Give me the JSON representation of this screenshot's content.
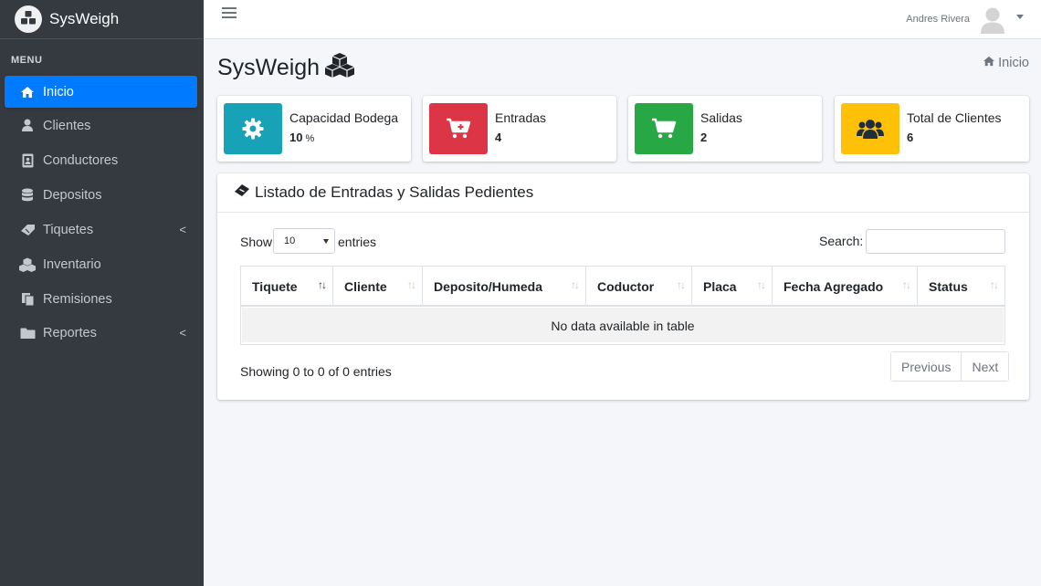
{
  "brand": {
    "name": "SysWeigh"
  },
  "sidebar": {
    "header": "MENU",
    "items": [
      {
        "label": "Inicio",
        "icon": "home-icon",
        "active": true
      },
      {
        "label": "Clientes",
        "icon": "user-icon"
      },
      {
        "label": "Conductores",
        "icon": "id-badge-icon"
      },
      {
        "label": "Depositos",
        "icon": "database-icon"
      },
      {
        "label": "Tiquetes",
        "icon": "ticket-icon",
        "has_submenu": true
      },
      {
        "label": "Inventario",
        "icon": "cubes-icon"
      },
      {
        "label": "Remisiones",
        "icon": "copy-icon"
      },
      {
        "label": "Reportes",
        "icon": "folder-icon",
        "has_submenu": true
      }
    ],
    "chevron": "<"
  },
  "header": {
    "user_name": "Andres Rivera"
  },
  "page": {
    "title": "SysWeigh",
    "breadcrumb": "Inicio"
  },
  "info_boxes": [
    {
      "label": "Capacidad Bodega",
      "value": "10",
      "unit": "%",
      "icon": "cog-icon",
      "color": "#17a2b8"
    },
    {
      "label": "Entradas",
      "value": "4",
      "icon": "cart-plus-icon",
      "color": "#dc3545"
    },
    {
      "label": "Salidas",
      "value": "2",
      "icon": "cart-icon",
      "color": "#28a745"
    },
    {
      "label": "Total de Clientes",
      "value": "6",
      "icon": "users-icon",
      "color": "#ffc107"
    }
  ],
  "card": {
    "title": "Listado de Entradas y Salidas Pedientes",
    "length": {
      "show": "Show",
      "value": "10",
      "entries": "entries"
    },
    "search_label": "Search:",
    "columns": [
      "Tiquete",
      "Cliente",
      "Deposito/Humeda",
      "Coductor",
      "Placa",
      "Fecha Agregado",
      "Status"
    ],
    "empty": "No data available in table",
    "info": "Showing 0 to 0 of 0 entries",
    "pagination": {
      "previous": "Previous",
      "next": "Next"
    }
  },
  "colors": {
    "sidebar_bg": "#343a40",
    "active": "#007bff",
    "body_bg": "#f4f6f9"
  }
}
